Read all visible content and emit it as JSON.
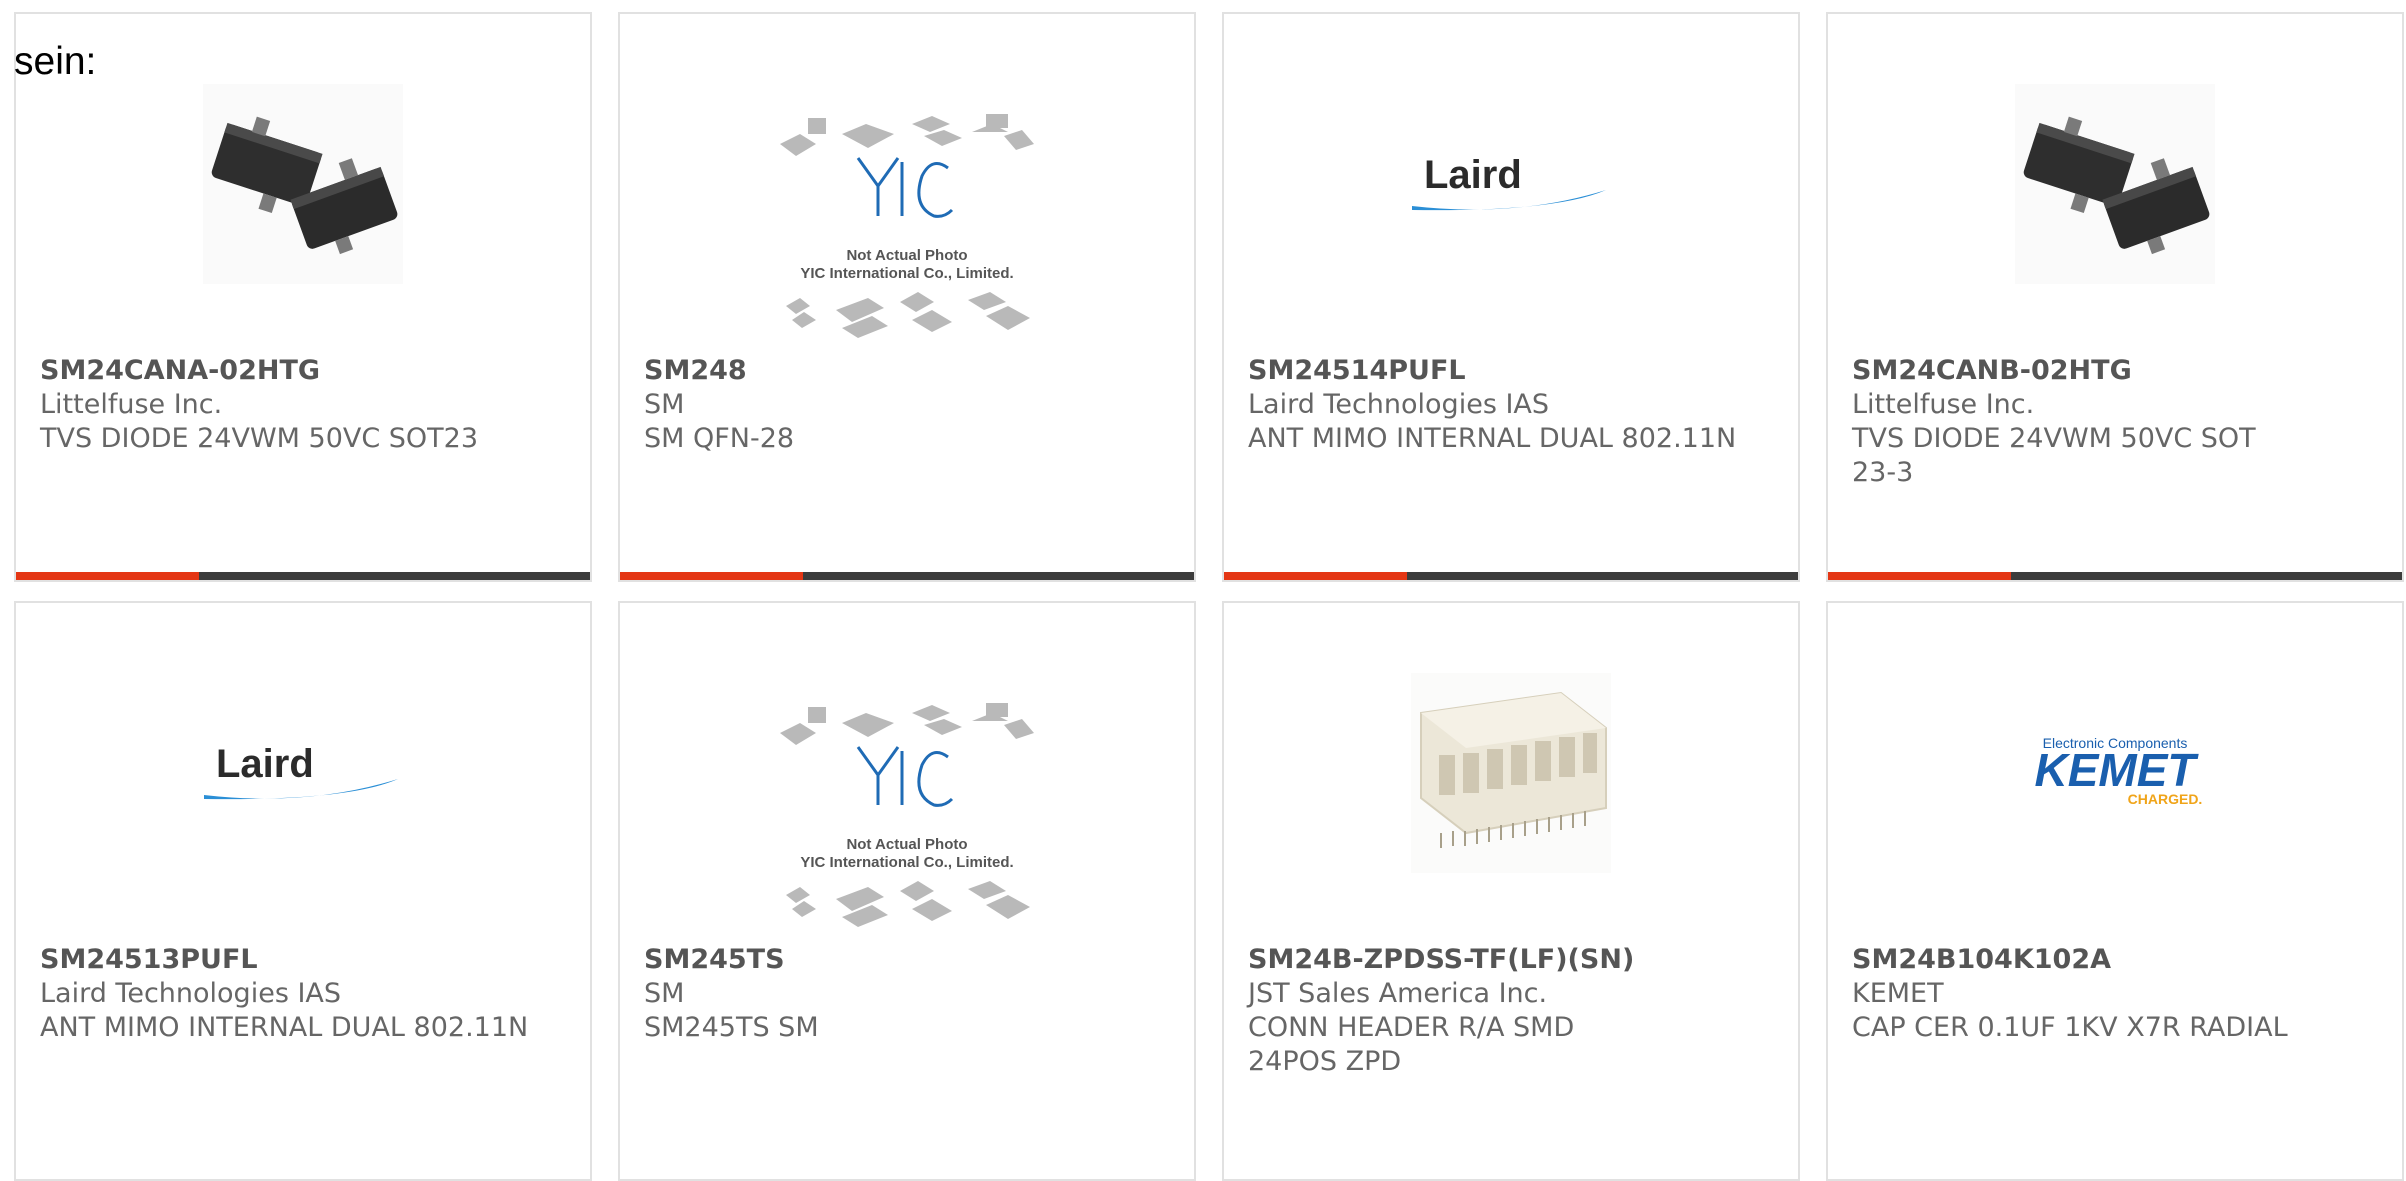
{
  "lead_text": "sein:",
  "products": [
    {
      "part": "SM24CANA-02HTG",
      "maker": "Littelfuse Inc.",
      "desc": "TVS DIODE 24VWM 50VC SOT23",
      "image": "sot23-package-photo"
    },
    {
      "part": "SM248",
      "maker": "SM",
      "desc": "SM QFN-28",
      "image": "yic-placeholder",
      "placeholder_note": "Not Actual Photo",
      "placeholder_company": "YIC International Co., Limited.",
      "placeholder_logo": "YIC"
    },
    {
      "part": "SM24514PUFL",
      "maker": "Laird Technologies IAS",
      "desc": "ANT MIMO INTERNAL DUAL 802.11N",
      "image": "laird-logo",
      "logo_text": "Laird"
    },
    {
      "part": "SM24CANB-02HTG",
      "maker": "Littelfuse Inc.",
      "desc": "TVS DIODE 24VWM 50VC SOT23-3",
      "image": "sot23-package-photo"
    },
    {
      "part": "SM24513PUFL",
      "maker": "Laird Technologies IAS",
      "desc": "ANT MIMO INTERNAL DUAL 802.11N",
      "image": "laird-logo",
      "logo_text": "Laird"
    },
    {
      "part": "SM245TS",
      "maker": "SM",
      "desc": "SM245TS SM",
      "image": "yic-placeholder",
      "placeholder_note": "Not Actual Photo",
      "placeholder_company": "YIC International Co., Limited.",
      "placeholder_logo": "YIC"
    },
    {
      "part": "SM24B-ZPDSS-TF(LF)(SN)",
      "maker": "JST Sales America Inc.",
      "desc": "CONN HEADER R/A SMD 24POS ZPD",
      "image": "connector-header-photo"
    },
    {
      "part": "SM24B104K102A",
      "maker": "KEMET",
      "desc": "CAP CER 0.1UF 1KV X7R RADIAL",
      "image": "kemet-logo",
      "logo_top": "Electronic Components",
      "logo_text": "KEMET",
      "logo_bottom": "CHARGED."
    }
  ],
  "colors": {
    "accent": "#e43614",
    "bar": "#3c3c3c",
    "text": "#666666",
    "border": "#e1e1e1"
  }
}
